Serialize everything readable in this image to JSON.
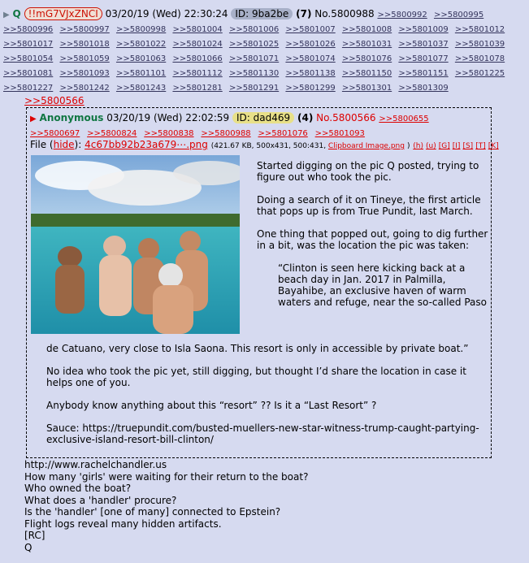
{
  "post": {
    "name": "Q",
    "tripcode": "!!mG7VJxZNCI",
    "datetime": "03/20/19 (Wed) 22:30:24",
    "id_label": "ID: 9ba2be",
    "reply_count": "(7)",
    "post_number": "No.5800988",
    "backlinks": [
      ">>5800992",
      ">>5800995",
      ">>5800996",
      ">>5800997",
      ">>5800998",
      ">>5801004",
      ">>5801006",
      ">>5801007",
      ">>5801008",
      ">>5801009",
      ">>5801012",
      ">>5801017",
      ">>5801018",
      ">>5801022",
      ">>5801024",
      ">>5801025",
      ">>5801026",
      ">>5801031",
      ">>5801037",
      ">>5801039",
      ">>5801054",
      ">>5801059",
      ">>5801063",
      ">>5801066",
      ">>5801071",
      ">>5801074",
      ">>5801076",
      ">>5801077",
      ">>5801078",
      ">>5801081",
      ">>5801093",
      ">>5801101",
      ">>5801112",
      ">>5801130",
      ">>5801138",
      ">>5801150",
      ">>5801151",
      ">>5801225",
      ">>5801227",
      ">>5801242",
      ">>5801243",
      ">>5801281",
      ">>5801291",
      ">>5801299",
      ">>5801301",
      ">>5801309"
    ],
    "quote_link": ">>5800566",
    "message_lines": [
      "http://www.rachelchandler.us",
      "How many 'girls' were waiting for their return to the boat?",
      "Who owned the boat?",
      "What does a 'handler' procure?",
      "Is the 'handler' [one of many] connected to Epstein?",
      "Flight logs reveal many hidden artifacts.",
      "[RC]",
      "Q"
    ]
  },
  "quoted_post": {
    "name": "Anonymous",
    "datetime": "03/20/19 (Wed) 22:02:59",
    "id_label": "ID: dad469",
    "reply_count": "(4)",
    "post_number": "No.5800566",
    "backlinks": [
      ">>5800655",
      ">>5800697",
      ">>5800824",
      ">>5800838",
      ">>5800988",
      ">>5801076",
      ">>5801093"
    ],
    "file": {
      "label": "File",
      "hide": "hide",
      "filename": "4c67bb92b23a679⋯.png",
      "meta": "(421.67 KB, 500x431, 500:431, ",
      "clipboard": "Clipboard Image.png",
      "meta_end": ")",
      "tools": [
        "(h)",
        "(u)",
        "[G]",
        "[I]",
        "[S]",
        "[T]",
        "[K]"
      ]
    },
    "text_right": [
      "Started digging on the pic Q posted, trying to figure out who took the pic.",
      "Doing a search of it on Tineye, the first article that pops up is from True Pundit, last March.",
      "One thing that popped out, going to dig further in a bit, was the location the pic was taken:"
    ],
    "quote_start": "“Clinton is seen here kicking back at a beach day in Jan. 2017 in Palmilla, Bayahibe, an exclusive haven of warm waters and refuge, near the so-called Paso",
    "quote_end": "de Catuano, very close to Isla Saona. This resort is only in accessible by private boat.”",
    "text_full": [
      "No idea who took the pic yet, still digging, but thought I’d share the location in case it helps one of you.",
      "Anybody know anything about this “resort” ?? Is it a “Last Resort” ?",
      "Sauce: https://truepundit.com/busted-muellers-new-star-witness-trump-caught-partying-exclusive-island-resort-bill-clinton/"
    ]
  },
  "colors": {
    "background": "#d6daf0",
    "name_green": "#117743",
    "link_red": "#dd0000",
    "id_badge_yellow": "#e8e088"
  }
}
